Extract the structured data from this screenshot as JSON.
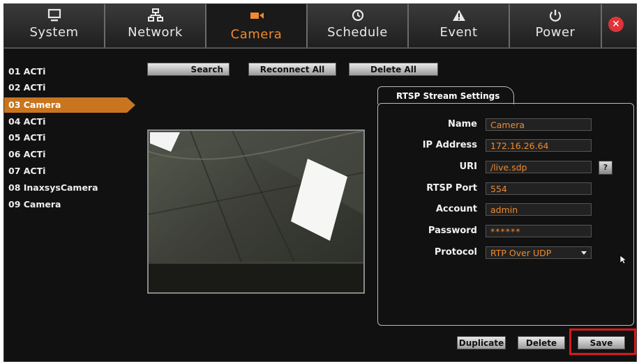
{
  "nav": {
    "tabs": [
      {
        "label": "System",
        "icon": "monitor-icon"
      },
      {
        "label": "Network",
        "icon": "network-icon"
      },
      {
        "label": "Camera",
        "icon": "camera-icon",
        "active": true
      },
      {
        "label": "Schedule",
        "icon": "clock-icon"
      },
      {
        "label": "Event",
        "icon": "warning-icon"
      },
      {
        "label": "Power",
        "icon": "power-icon"
      }
    ],
    "close_label": "✕",
    "accent_color": "#f08a2c"
  },
  "cameras": [
    "01 ACTi",
    "02 ACTi",
    "03 Camera",
    "04 ACTi",
    "05 ACTi",
    "06 ACTi",
    "07 ACTi",
    "08 InaxsysCamera",
    "09 Camera"
  ],
  "selected_camera": "03 Camera",
  "toolbar": {
    "search": "Search",
    "reconnect_all": "Reconnect All",
    "delete_all": "Delete All"
  },
  "rtsp": {
    "tab_title": "RTSP Stream Settings",
    "fields": {
      "name": {
        "label": "Name",
        "value": "Camera"
      },
      "ip": {
        "label": "IP Address",
        "value": "172.16.26.64"
      },
      "uri": {
        "label": "URI",
        "value": "/live.sdp"
      },
      "port": {
        "label": "RTSP Port",
        "value": "554"
      },
      "account": {
        "label": "Account",
        "value": "admin"
      },
      "password": {
        "label": "Password",
        "value": "******"
      },
      "protocol": {
        "label": "Protocol",
        "value": "RTP Over UDP"
      }
    },
    "help_label": "?"
  },
  "actions": {
    "duplicate": "Duplicate",
    "delete": "Delete",
    "save": "Save"
  }
}
